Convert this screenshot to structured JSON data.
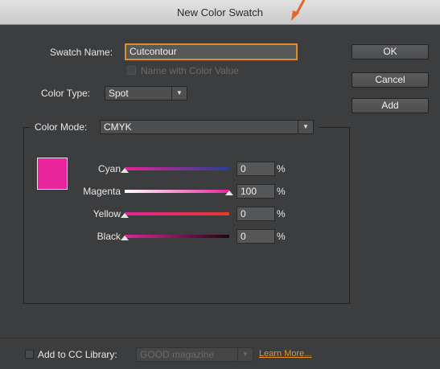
{
  "window": {
    "title": "New Color Swatch"
  },
  "swatch_name": {
    "label": "Swatch Name:",
    "value": "Cutcontour"
  },
  "name_with_color_value": {
    "label": "Name with Color Value",
    "checked": false,
    "enabled": false
  },
  "color_type": {
    "label": "Color Type:",
    "value": "Spot"
  },
  "buttons": {
    "ok": "OK",
    "cancel": "Cancel",
    "add": "Add"
  },
  "color_mode": {
    "label": "Color Mode:",
    "value": "CMYK"
  },
  "preview_color": "#e8239b",
  "components": [
    {
      "label": "Cyan",
      "value": "0",
      "unit": "%",
      "level": 0.0,
      "gradient": [
        "#e8239b",
        "#2a3d99"
      ]
    },
    {
      "label": "Magenta",
      "value": "100",
      "unit": "%",
      "level": 1.0,
      "gradient": [
        "#ffffff",
        "#e8239b"
      ]
    },
    {
      "label": "Yellow",
      "value": "0",
      "unit": "%",
      "level": 0.0,
      "gradient": [
        "#e8239b",
        "#e83a2a"
      ]
    },
    {
      "label": "Black",
      "value": "0",
      "unit": "%",
      "level": 0.0,
      "gradient": [
        "#e8239b",
        "#1a0810"
      ]
    }
  ],
  "cc_library": {
    "label": "Add to CC Library:",
    "checked": false,
    "library": "GOOD magazine",
    "learn_more": "Learn More..."
  },
  "accent_color": "#e8941f"
}
